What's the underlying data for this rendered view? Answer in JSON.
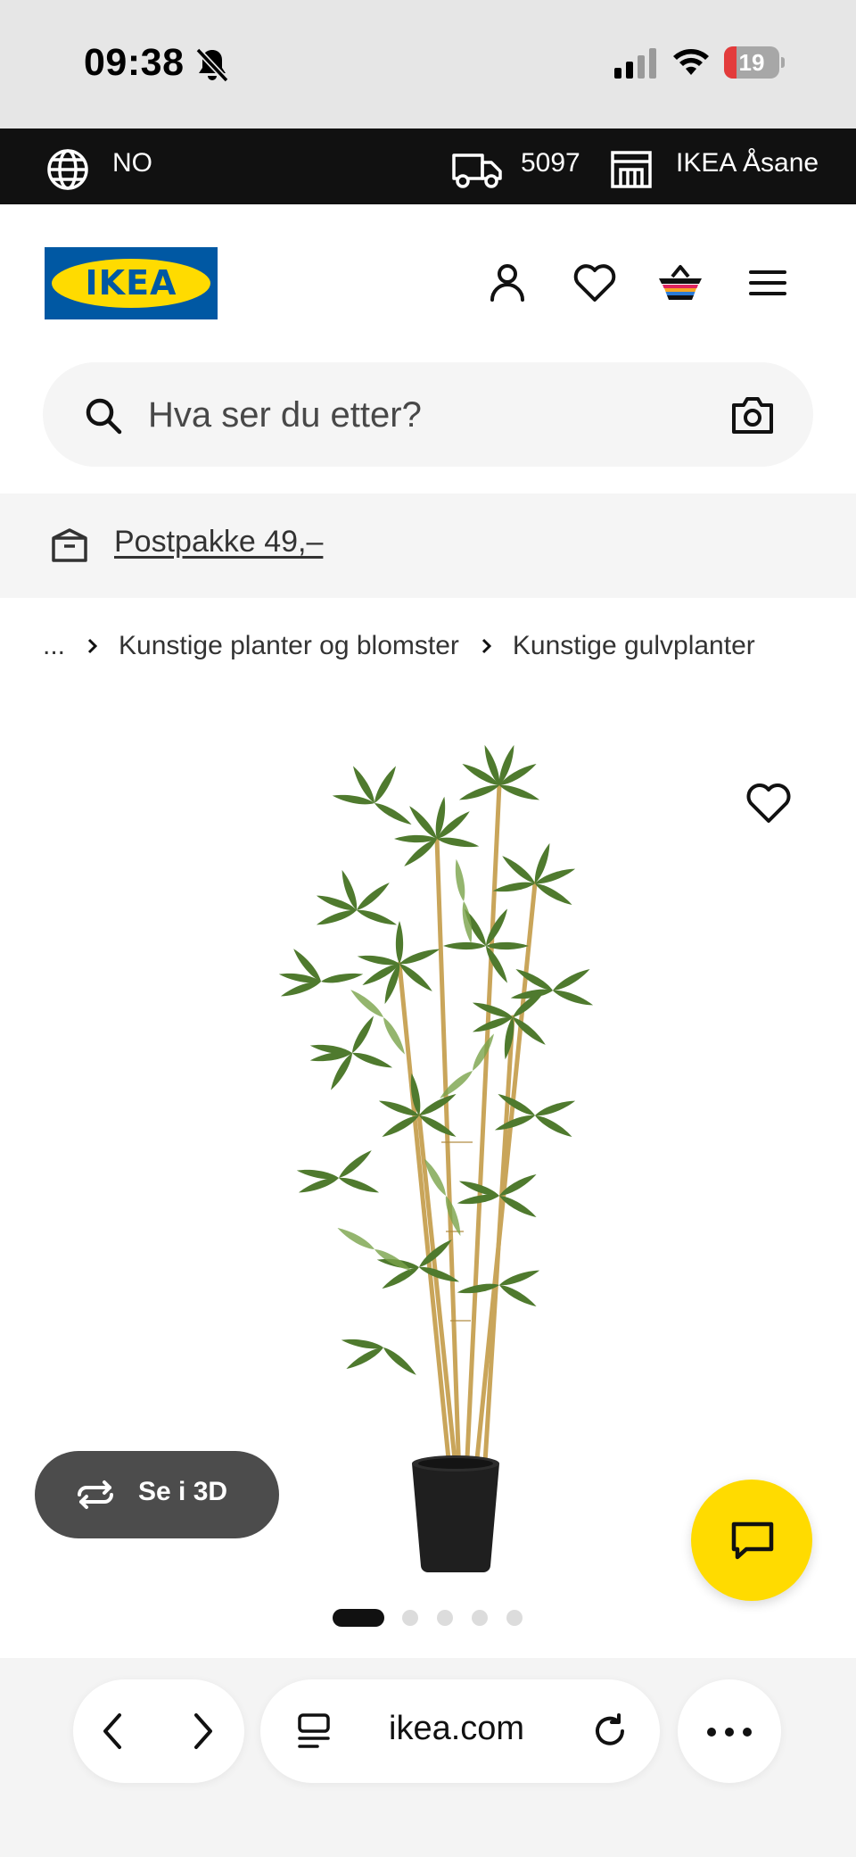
{
  "status_bar": {
    "time": "09:38",
    "battery_level": "19",
    "icons": [
      "bell-slash-icon",
      "cellular-signal-icon",
      "wifi-icon",
      "battery-icon"
    ]
  },
  "top_strip": {
    "language": "NO",
    "postcode": "5097",
    "store": "IKEA Åsane",
    "icons": [
      "globe-icon",
      "truck-icon",
      "store-icon"
    ]
  },
  "header": {
    "logo_text": "IKEA",
    "icons": [
      "account-icon",
      "heart-icon",
      "basket-icon",
      "hamburger-menu-icon"
    ]
  },
  "search": {
    "placeholder": "Hva ser du etter?",
    "icons": [
      "search-icon",
      "camera-icon"
    ]
  },
  "banner": {
    "text": "Postpakke 49,–",
    "icon": "parcel-icon"
  },
  "breadcrumb": {
    "ellipsis": "...",
    "items": [
      "Kunstige planter og blomster",
      "Kunstige gulvplanter"
    ]
  },
  "product": {
    "image_alt": "artificial bamboo plant in black pot",
    "view_3d_label": "Se i 3D",
    "carousel": {
      "total": 5,
      "active": 1
    }
  },
  "safari": {
    "url": "ikea.com",
    "icons": [
      "back-icon",
      "forward-icon",
      "tabs-icon",
      "reload-icon",
      "more-icon"
    ]
  },
  "colors": {
    "ikea_blue": "#0058a3",
    "ikea_yellow": "#ffdb00",
    "top_strip_bg": "#111111",
    "button_3d_bg": "#4c4c4c"
  }
}
